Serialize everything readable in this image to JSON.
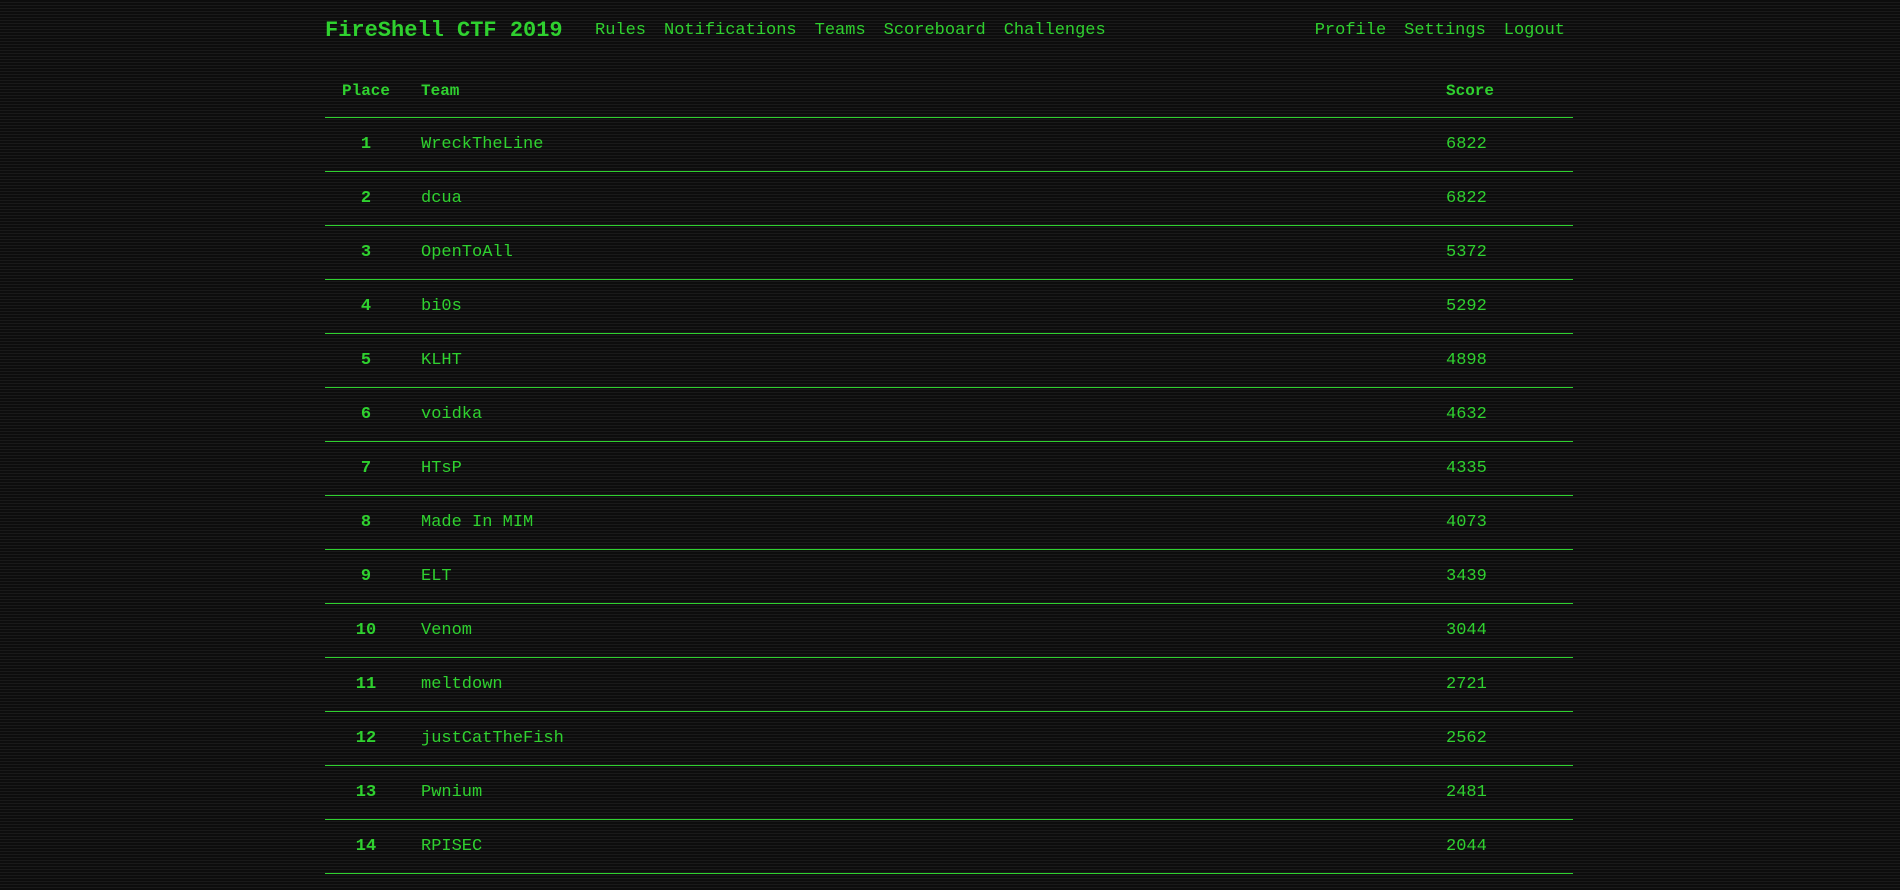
{
  "navbar": {
    "brand": "FireShell CTF 2019",
    "left_links": [
      "Rules",
      "Notifications",
      "Teams",
      "Scoreboard",
      "Challenges"
    ],
    "right_links": [
      "Profile",
      "Settings",
      "Logout"
    ]
  },
  "scoreboard": {
    "headers": {
      "place": "Place",
      "team": "Team",
      "score": "Score"
    },
    "rows": [
      {
        "place": "1",
        "team": "WreckTheLine",
        "score": "6822"
      },
      {
        "place": "2",
        "team": "dcua",
        "score": "6822"
      },
      {
        "place": "3",
        "team": "OpenToAll",
        "score": "5372"
      },
      {
        "place": "4",
        "team": "bi0s",
        "score": "5292"
      },
      {
        "place": "5",
        "team": "KLHT",
        "score": "4898"
      },
      {
        "place": "6",
        "team": "voidka",
        "score": "4632"
      },
      {
        "place": "7",
        "team": "HTsP",
        "score": "4335"
      },
      {
        "place": "8",
        "team": "Made In MIM",
        "score": "4073"
      },
      {
        "place": "9",
        "team": "ELT",
        "score": "3439"
      },
      {
        "place": "10",
        "team": "Venom",
        "score": "3044"
      },
      {
        "place": "11",
        "team": "meltdown",
        "score": "2721"
      },
      {
        "place": "12",
        "team": "justCatTheFish",
        "score": "2562"
      },
      {
        "place": "13",
        "team": "Pwnium",
        "score": "2481"
      },
      {
        "place": "14",
        "team": "RPISEC",
        "score": "2044"
      }
    ]
  },
  "theme": {
    "accent": "#2fd12f",
    "background": "#0d0d0d"
  }
}
